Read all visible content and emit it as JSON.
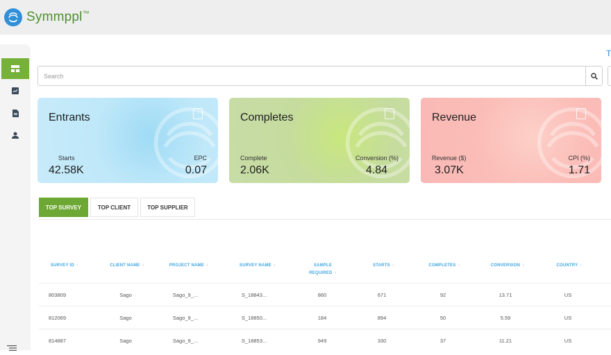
{
  "app": {
    "brand": "Symmppl",
    "brand_mark": "™"
  },
  "top_link": "T",
  "search": {
    "placeholder": "Search"
  },
  "cards": [
    {
      "title": "Entrants",
      "left_label": "Starts",
      "left_value": "42.58K",
      "right_label": "EPC",
      "right_value": "0.07"
    },
    {
      "title": "Completes",
      "left_label": "Complete",
      "left_value": "2.06K",
      "right_label": "Conversion (%)",
      "right_value": "4.84"
    },
    {
      "title": "Revenue",
      "left_label": "Revenue ($)",
      "left_value": "3.07K",
      "right_label": "CPI (%)",
      "right_value": "1.71"
    }
  ],
  "tabs": [
    "TOP SURVEY",
    "TOP CLIENT",
    "TOP SUPPLIER"
  ],
  "table": {
    "headers": [
      "SURVEY ID",
      "CLIENT NAME",
      "PROJECT NAME",
      "SURVEY NAME",
      "SAMPLE REQUIRED",
      "STARTS",
      "COMPLETES",
      "CONVERSION",
      "COUNTRY"
    ],
    "rows": [
      [
        "803809",
        "Sago",
        "Sago_9_...",
        "S_18843...",
        "860",
        "671",
        "92",
        "13.71",
        "US"
      ],
      [
        "812069",
        "Sago",
        "Sago_9_...",
        "S_18850...",
        "184",
        "894",
        "50",
        "5.59",
        "US"
      ],
      [
        "814887",
        "Sago",
        "Sago_9_...",
        "S_18853...",
        "949",
        "330",
        "37",
        "11.21",
        "US"
      ]
    ]
  },
  "sidebar": {
    "items": [
      "dashboard-icon",
      "report-icon",
      "document-icon",
      "user-icon"
    ],
    "bottom": "list-settings-icon"
  },
  "colors": {
    "accent": "#76b13a",
    "header_text": "#42a7e6",
    "brand": "#4f8f2e"
  }
}
